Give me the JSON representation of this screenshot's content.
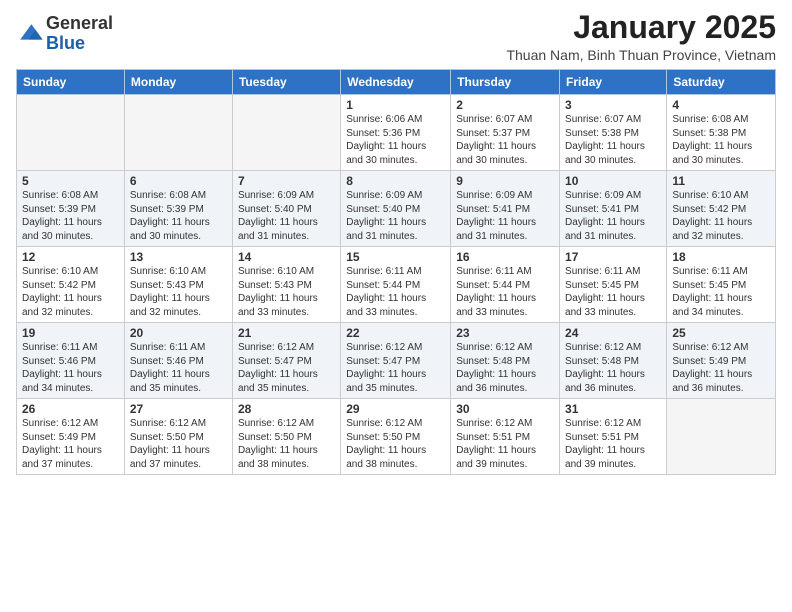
{
  "logo": {
    "general": "General",
    "blue": "Blue"
  },
  "title": "January 2025",
  "location": "Thuan Nam, Binh Thuan Province, Vietnam",
  "days_of_week": [
    "Sunday",
    "Monday",
    "Tuesday",
    "Wednesday",
    "Thursday",
    "Friday",
    "Saturday"
  ],
  "weeks": [
    [
      {
        "num": "",
        "info": ""
      },
      {
        "num": "",
        "info": ""
      },
      {
        "num": "",
        "info": ""
      },
      {
        "num": "1",
        "info": "Sunrise: 6:06 AM\nSunset: 5:36 PM\nDaylight: 11 hours\nand 30 minutes."
      },
      {
        "num": "2",
        "info": "Sunrise: 6:07 AM\nSunset: 5:37 PM\nDaylight: 11 hours\nand 30 minutes."
      },
      {
        "num": "3",
        "info": "Sunrise: 6:07 AM\nSunset: 5:38 PM\nDaylight: 11 hours\nand 30 minutes."
      },
      {
        "num": "4",
        "info": "Sunrise: 6:08 AM\nSunset: 5:38 PM\nDaylight: 11 hours\nand 30 minutes."
      }
    ],
    [
      {
        "num": "5",
        "info": "Sunrise: 6:08 AM\nSunset: 5:39 PM\nDaylight: 11 hours\nand 30 minutes."
      },
      {
        "num": "6",
        "info": "Sunrise: 6:08 AM\nSunset: 5:39 PM\nDaylight: 11 hours\nand 30 minutes."
      },
      {
        "num": "7",
        "info": "Sunrise: 6:09 AM\nSunset: 5:40 PM\nDaylight: 11 hours\nand 31 minutes."
      },
      {
        "num": "8",
        "info": "Sunrise: 6:09 AM\nSunset: 5:40 PM\nDaylight: 11 hours\nand 31 minutes."
      },
      {
        "num": "9",
        "info": "Sunrise: 6:09 AM\nSunset: 5:41 PM\nDaylight: 11 hours\nand 31 minutes."
      },
      {
        "num": "10",
        "info": "Sunrise: 6:09 AM\nSunset: 5:41 PM\nDaylight: 11 hours\nand 31 minutes."
      },
      {
        "num": "11",
        "info": "Sunrise: 6:10 AM\nSunset: 5:42 PM\nDaylight: 11 hours\nand 32 minutes."
      }
    ],
    [
      {
        "num": "12",
        "info": "Sunrise: 6:10 AM\nSunset: 5:42 PM\nDaylight: 11 hours\nand 32 minutes."
      },
      {
        "num": "13",
        "info": "Sunrise: 6:10 AM\nSunset: 5:43 PM\nDaylight: 11 hours\nand 32 minutes."
      },
      {
        "num": "14",
        "info": "Sunrise: 6:10 AM\nSunset: 5:43 PM\nDaylight: 11 hours\nand 33 minutes."
      },
      {
        "num": "15",
        "info": "Sunrise: 6:11 AM\nSunset: 5:44 PM\nDaylight: 11 hours\nand 33 minutes."
      },
      {
        "num": "16",
        "info": "Sunrise: 6:11 AM\nSunset: 5:44 PM\nDaylight: 11 hours\nand 33 minutes."
      },
      {
        "num": "17",
        "info": "Sunrise: 6:11 AM\nSunset: 5:45 PM\nDaylight: 11 hours\nand 33 minutes."
      },
      {
        "num": "18",
        "info": "Sunrise: 6:11 AM\nSunset: 5:45 PM\nDaylight: 11 hours\nand 34 minutes."
      }
    ],
    [
      {
        "num": "19",
        "info": "Sunrise: 6:11 AM\nSunset: 5:46 PM\nDaylight: 11 hours\nand 34 minutes."
      },
      {
        "num": "20",
        "info": "Sunrise: 6:11 AM\nSunset: 5:46 PM\nDaylight: 11 hours\nand 35 minutes."
      },
      {
        "num": "21",
        "info": "Sunrise: 6:12 AM\nSunset: 5:47 PM\nDaylight: 11 hours\nand 35 minutes."
      },
      {
        "num": "22",
        "info": "Sunrise: 6:12 AM\nSunset: 5:47 PM\nDaylight: 11 hours\nand 35 minutes."
      },
      {
        "num": "23",
        "info": "Sunrise: 6:12 AM\nSunset: 5:48 PM\nDaylight: 11 hours\nand 36 minutes."
      },
      {
        "num": "24",
        "info": "Sunrise: 6:12 AM\nSunset: 5:48 PM\nDaylight: 11 hours\nand 36 minutes."
      },
      {
        "num": "25",
        "info": "Sunrise: 6:12 AM\nSunset: 5:49 PM\nDaylight: 11 hours\nand 36 minutes."
      }
    ],
    [
      {
        "num": "26",
        "info": "Sunrise: 6:12 AM\nSunset: 5:49 PM\nDaylight: 11 hours\nand 37 minutes."
      },
      {
        "num": "27",
        "info": "Sunrise: 6:12 AM\nSunset: 5:50 PM\nDaylight: 11 hours\nand 37 minutes."
      },
      {
        "num": "28",
        "info": "Sunrise: 6:12 AM\nSunset: 5:50 PM\nDaylight: 11 hours\nand 38 minutes."
      },
      {
        "num": "29",
        "info": "Sunrise: 6:12 AM\nSunset: 5:50 PM\nDaylight: 11 hours\nand 38 minutes."
      },
      {
        "num": "30",
        "info": "Sunrise: 6:12 AM\nSunset: 5:51 PM\nDaylight: 11 hours\nand 39 minutes."
      },
      {
        "num": "31",
        "info": "Sunrise: 6:12 AM\nSunset: 5:51 PM\nDaylight: 11 hours\nand 39 minutes."
      },
      {
        "num": "",
        "info": ""
      }
    ]
  ]
}
